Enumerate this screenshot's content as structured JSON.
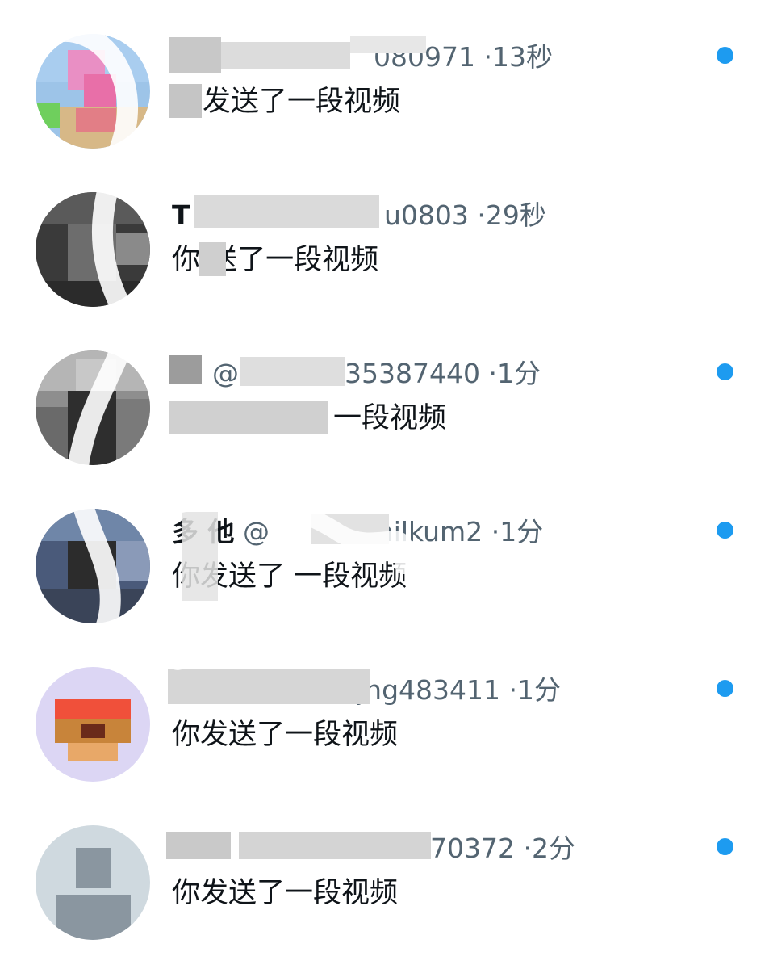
{
  "colors": {
    "primary_text": "#0f1419",
    "secondary_text": "#536471",
    "unread_dot": "#1d9bf0",
    "background": "#ffffff"
  },
  "conversations": [
    {
      "handle_visible": "",
      "handle_tail": "080971",
      "time": "13秒",
      "message": "发送了一段视频",
      "unread": true
    },
    {
      "handle_visible": "",
      "handle_tail": "u0803",
      "time": "29秒",
      "message": "你 送了一段视频",
      "unread": false
    },
    {
      "handle_visible": "@",
      "handle_tail": "535387440",
      "time": "1分",
      "message": "一段视频",
      "unread": true
    },
    {
      "display_name": "多 他",
      "handle_visible": "@",
      "handle_tail": "aAnilkum2",
      "time": "1分",
      "message": "你发送了 一段视频",
      "unread": true
    },
    {
      "handle_visible": "",
      "handle_tail": "jng483411",
      "time": "1分",
      "message": "你发送了一段视频",
      "unread": true
    },
    {
      "handle_visible": "",
      "handle_tail": "70372",
      "time": "2分",
      "message": "你发送了一段视频",
      "unread": true
    }
  ],
  "separator": "·"
}
